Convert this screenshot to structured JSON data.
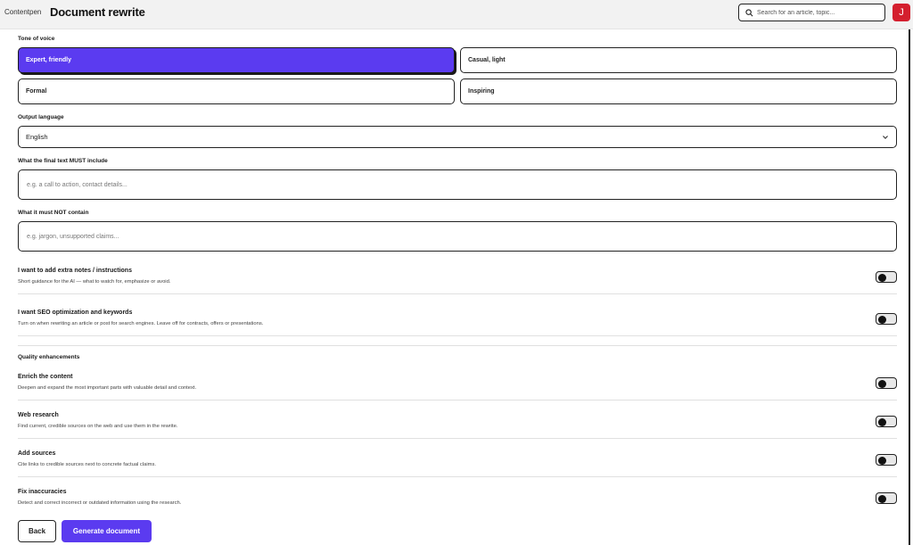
{
  "header": {
    "brand": "Contentpen",
    "title": "Document rewrite",
    "search_placeholder": "Search for an article, topic...",
    "avatar_initial": "J"
  },
  "tone": {
    "label": "Tone of voice",
    "options": [
      "Expert, friendly",
      "Casual, light",
      "Formal",
      "Inspiring"
    ],
    "selected": "Expert, friendly"
  },
  "language": {
    "label": "Output language",
    "value": "English"
  },
  "must_include": {
    "label": "What the final text MUST include",
    "placeholder": "e.g. a call to action, contact details..."
  },
  "must_not": {
    "label": "What it must NOT contain",
    "placeholder": "e.g. jargon, unsupported claims..."
  },
  "options": [
    {
      "title": "I want to add extra notes / instructions",
      "desc": "Short guidance for the AI — what to watch for, emphasize or avoid."
    },
    {
      "title": "I want SEO optimization and keywords",
      "desc": "Turn on when rewriting an article or post for search engines. Leave off for contracts, offers or presentations."
    }
  ],
  "quality": {
    "heading": "Quality enhancements",
    "items": [
      {
        "title": "Enrich the content",
        "desc": "Deepen and expand the most important parts with valuable detail and context."
      },
      {
        "title": "Web research",
        "desc": "Find current, credible sources on the web and use them in the rewrite."
      },
      {
        "title": "Add sources",
        "desc": "Cite links to credible sources next to concrete factual claims."
      },
      {
        "title": "Fix inaccuracies",
        "desc": "Detect and correct incorrect or outdated information using the research."
      }
    ]
  },
  "actions": {
    "back": "Back",
    "generate": "Generate document"
  },
  "colors": {
    "accent": "#5b3bf0",
    "avatar": "#d41f2e"
  }
}
